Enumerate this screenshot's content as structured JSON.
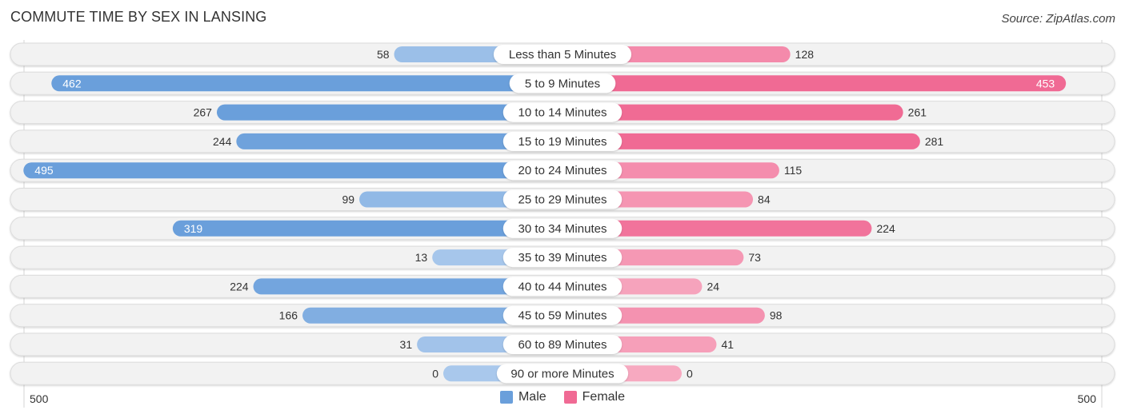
{
  "header": {
    "title": "COMMUTE TIME BY SEX IN LANSING",
    "source": "Source: ZipAtlas.com"
  },
  "colors": {
    "male": "#6a9fdb",
    "male_light": "#a9c8ec",
    "female": "#f06a94",
    "female_light": "#f7a9c0",
    "track": "#f2f2f2"
  },
  "chart_data": {
    "type": "bar",
    "orientation": "horizontal-diverging",
    "title": "COMMUTE TIME BY SEX IN LANSING",
    "categories": [
      "Less than 5 Minutes",
      "5 to 9 Minutes",
      "10 to 14 Minutes",
      "15 to 19 Minutes",
      "20 to 24 Minutes",
      "25 to 29 Minutes",
      "30 to 34 Minutes",
      "35 to 39 Minutes",
      "40 to 44 Minutes",
      "45 to 59 Minutes",
      "60 to 89 Minutes",
      "90 or more Minutes"
    ],
    "series": [
      {
        "name": "Male",
        "values": [
          58,
          462,
          267,
          244,
          495,
          99,
          319,
          13,
          224,
          166,
          31,
          0
        ]
      },
      {
        "name": "Female",
        "values": [
          128,
          453,
          261,
          281,
          115,
          84,
          224,
          73,
          24,
          98,
          41,
          0
        ]
      }
    ],
    "axis": {
      "left_label": "500",
      "right_label": "500",
      "max": 500
    },
    "legend": {
      "position": "bottom-center",
      "items": [
        "Male",
        "Female"
      ]
    }
  }
}
